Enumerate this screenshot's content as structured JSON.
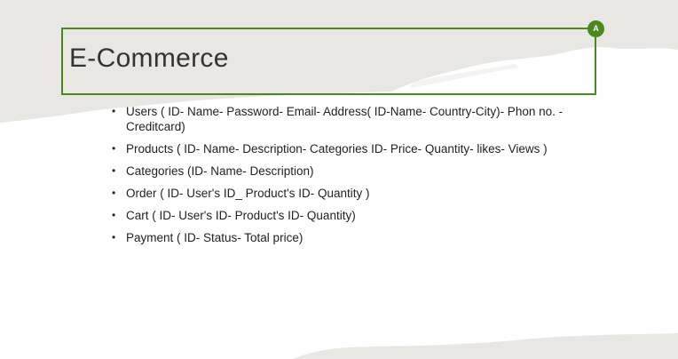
{
  "slide": {
    "title": "E-Commerce",
    "comment_marker": "A",
    "bullet_char": "•",
    "bullets": [
      "Users ( ID- Name- Password- Email- Address( ID-Name- Country-City)- Phon no. - Creditcard)",
      "Products ( ID- Name- Description- Categories ID- Price- Quantity- likes- Views )",
      "Categories (ID- Name- Description)",
      "Order ( ID- User's ID_ Product's ID- Quantity )",
      "Cart ( ID- User's ID- Product's ID- Quantity)",
      "Payment ( ID- Status- Total price)"
    ]
  },
  "colors": {
    "accent": "#4a8a1c",
    "texture": "#e7e6e3",
    "text": "#222222"
  }
}
